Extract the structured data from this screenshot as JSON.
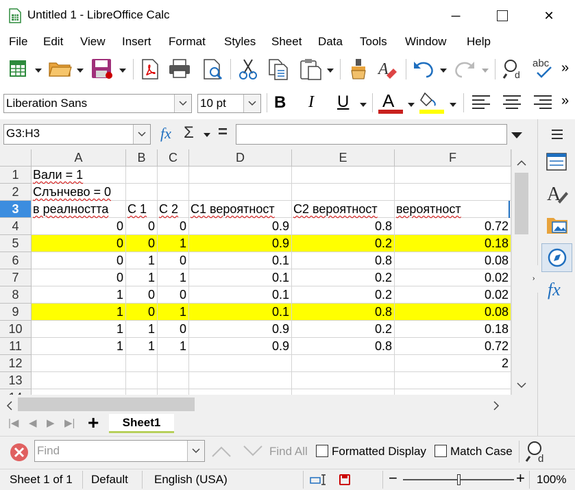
{
  "window": {
    "title": "Untitled 1 - LibreOffice Calc",
    "minimize": "─",
    "maximize": "☐",
    "close": "✕"
  },
  "menu": [
    "File",
    "Edit",
    "View",
    "Insert",
    "Format",
    "Styles",
    "Sheet",
    "Data",
    "Tools",
    "Window",
    "Help"
  ],
  "font": {
    "name": "Liberation Sans",
    "size": "10 pt"
  },
  "formula_bar": {
    "name_box": "G3:H3",
    "content": ""
  },
  "columns": [
    "A",
    "B",
    "C",
    "D",
    "E",
    "F"
  ],
  "rows": [
    {
      "n": "1",
      "cells": [
        "Вали = 1",
        "",
        "",
        "",
        "",
        ""
      ]
    },
    {
      "n": "2",
      "cells": [
        "Слънчево = 0",
        "",
        "",
        "",
        "",
        ""
      ]
    },
    {
      "n": "3",
      "cells": [
        "в реалността",
        "С 1",
        "С 2",
        "С1 вероятност",
        "С2 вероятност",
        "вероятност"
      ]
    },
    {
      "n": "4",
      "cells": [
        "0",
        "0",
        "0",
        "0.9",
        "0.8",
        "0.72"
      ]
    },
    {
      "n": "5",
      "cells": [
        "0",
        "0",
        "1",
        "0.9",
        "0.2",
        "0.18"
      ]
    },
    {
      "n": "6",
      "cells": [
        "0",
        "1",
        "0",
        "0.1",
        "0.8",
        "0.08"
      ]
    },
    {
      "n": "7",
      "cells": [
        "0",
        "1",
        "1",
        "0.1",
        "0.2",
        "0.02"
      ]
    },
    {
      "n": "8",
      "cells": [
        "1",
        "0",
        "0",
        "0.1",
        "0.2",
        "0.02"
      ]
    },
    {
      "n": "9",
      "cells": [
        "1",
        "0",
        "1",
        "0.1",
        "0.8",
        "0.08"
      ]
    },
    {
      "n": "10",
      "cells": [
        "1",
        "1",
        "0",
        "0.9",
        "0.2",
        "0.18"
      ]
    },
    {
      "n": "11",
      "cells": [
        "1",
        "1",
        "1",
        "0.9",
        "0.8",
        "0.72"
      ]
    },
    {
      "n": "12",
      "cells": [
        "",
        "",
        "",
        "",
        "",
        "2"
      ]
    },
    {
      "n": "13",
      "cells": [
        "",
        "",
        "",
        "",
        "",
        ""
      ]
    },
    {
      "n": "14",
      "cells": [
        "",
        "",
        "",
        "",
        "",
        ""
      ]
    }
  ],
  "highlight_color": "#ffff00",
  "sheet_tabs": {
    "active": "Sheet1",
    "add": "+"
  },
  "find_bar": {
    "placeholder": "Find",
    "find_all": "Find All",
    "formatted_display": "Formatted Display",
    "match_case": "Match Case"
  },
  "status": {
    "sheet": "Sheet 1 of 1",
    "style": "Default",
    "language": "English (USA)",
    "zoom": "100%",
    "zoom_fraction": 0.5
  },
  "formula_icons": {
    "fx": "fx",
    "sigma": "Σ",
    "equals": "="
  }
}
